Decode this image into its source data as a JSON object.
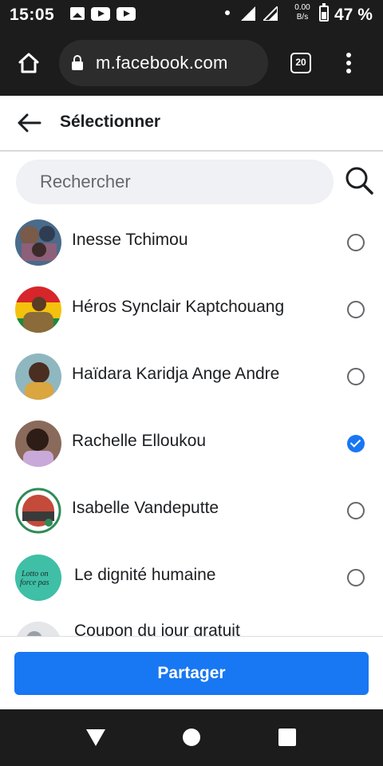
{
  "status_bar": {
    "time": "15:05",
    "speed_value": "0.00",
    "speed_unit": "B/s",
    "battery_percent": "47 %",
    "icons": [
      "image-icon",
      "youtube-icon",
      "youtube-icon",
      "dot-icon",
      "signal-icon",
      "signal-icon",
      "battery-icon"
    ]
  },
  "browser": {
    "url": "m.facebook.com",
    "tab_count": "20",
    "icons": [
      "home-icon",
      "lock-icon",
      "tabs-icon",
      "menu-icon"
    ]
  },
  "header": {
    "title": "Sélectionner",
    "back_icon": "arrow-left-icon"
  },
  "search": {
    "placeholder": "Rechercher",
    "icon": "search-icon"
  },
  "contacts": [
    {
      "name": "Inesse Tchimou",
      "selected": false
    },
    {
      "name": "Héros Synclair Kaptchouang",
      "selected": false
    },
    {
      "name": "Haïdara Karidja Ange Andre",
      "selected": false
    },
    {
      "name": "Rachelle Elloukou",
      "selected": true
    },
    {
      "name": "Isabelle Vandeputte",
      "selected": false
    },
    {
      "name": "Le dignité humaine",
      "selected": false
    },
    {
      "name": "Coupon du jour gratuit",
      "selected": false
    }
  ],
  "avatar_badge": {
    "line1": "Lotto on",
    "line2": "force pas"
  },
  "footer": {
    "share_label": "Partager"
  },
  "colors": {
    "accent": "#1877f2",
    "system_bar": "#1c1c1c",
    "search_bg": "#eff1f4"
  }
}
